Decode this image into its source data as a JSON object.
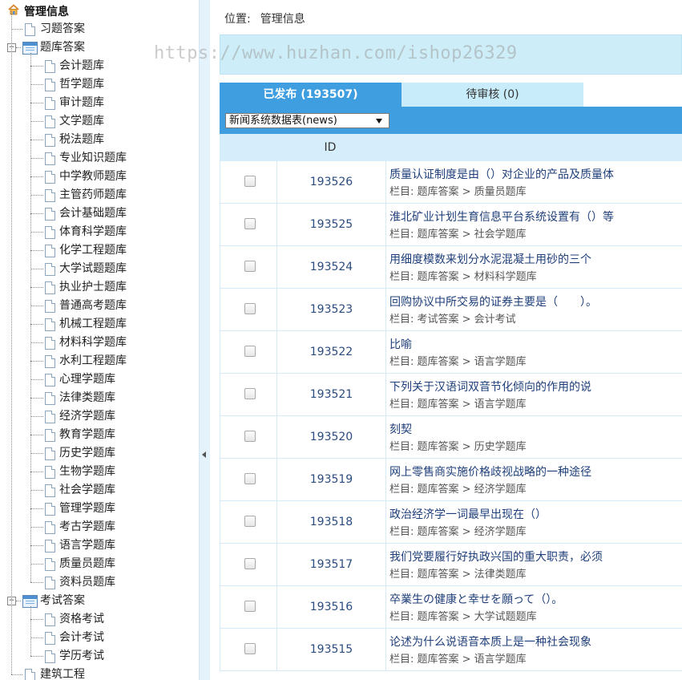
{
  "sidebar": {
    "root_label": "管理信息",
    "items": [
      {
        "label": "习题答案",
        "level": 1,
        "type": "doc"
      },
      {
        "label": "题库答案",
        "level": 1,
        "type": "folder",
        "expanded": true
      },
      {
        "label": "会计题库",
        "level": 2,
        "type": "doc"
      },
      {
        "label": "哲学题库",
        "level": 2,
        "type": "doc"
      },
      {
        "label": "审计题库",
        "level": 2,
        "type": "doc"
      },
      {
        "label": "文学题库",
        "level": 2,
        "type": "doc"
      },
      {
        "label": "税法题库",
        "level": 2,
        "type": "doc"
      },
      {
        "label": "专业知识题库",
        "level": 2,
        "type": "doc"
      },
      {
        "label": "中学教师题库",
        "level": 2,
        "type": "doc"
      },
      {
        "label": "主管药师题库",
        "level": 2,
        "type": "doc"
      },
      {
        "label": "会计基础题库",
        "level": 2,
        "type": "doc"
      },
      {
        "label": "体育科学题库",
        "level": 2,
        "type": "doc"
      },
      {
        "label": "化学工程题库",
        "level": 2,
        "type": "doc"
      },
      {
        "label": "大学试题题库",
        "level": 2,
        "type": "doc"
      },
      {
        "label": "执业护士题库",
        "level": 2,
        "type": "doc"
      },
      {
        "label": "普通高考题库",
        "level": 2,
        "type": "doc"
      },
      {
        "label": "机械工程题库",
        "level": 2,
        "type": "doc"
      },
      {
        "label": "材料科学题库",
        "level": 2,
        "type": "doc"
      },
      {
        "label": "水利工程题库",
        "level": 2,
        "type": "doc"
      },
      {
        "label": "心理学题库",
        "level": 2,
        "type": "doc"
      },
      {
        "label": "法律类题库",
        "level": 2,
        "type": "doc"
      },
      {
        "label": "经济学题库",
        "level": 2,
        "type": "doc"
      },
      {
        "label": "教育学题库",
        "level": 2,
        "type": "doc"
      },
      {
        "label": "历史学题库",
        "level": 2,
        "type": "doc"
      },
      {
        "label": "生物学题库",
        "level": 2,
        "type": "doc"
      },
      {
        "label": "社会学题库",
        "level": 2,
        "type": "doc"
      },
      {
        "label": "管理学题库",
        "level": 2,
        "type": "doc"
      },
      {
        "label": "考古学题库",
        "level": 2,
        "type": "doc"
      },
      {
        "label": "语言学题库",
        "level": 2,
        "type": "doc"
      },
      {
        "label": "质量员题库",
        "level": 2,
        "type": "doc"
      },
      {
        "label": "资料员题库",
        "level": 2,
        "type": "doc"
      },
      {
        "label": "考试答案",
        "level": 1,
        "type": "folder",
        "expanded": true
      },
      {
        "label": "资格考试",
        "level": 2,
        "type": "doc"
      },
      {
        "label": "会计考试",
        "level": 2,
        "type": "doc"
      },
      {
        "label": "学历考试",
        "level": 2,
        "type": "doc"
      },
      {
        "label": "建筑工程",
        "level": 1,
        "type": "doc"
      }
    ]
  },
  "breadcrumb": {
    "label": "位置:",
    "value": "管理信息"
  },
  "watermark": "https://www.huzhan.com/ishop26329",
  "tabs": [
    {
      "label": "已发布 (193507)",
      "active": true
    },
    {
      "label": "待审核 (0)",
      "active": false
    }
  ],
  "filter": {
    "selected": "新闻系统数据表(news)"
  },
  "table": {
    "id_header": "ID",
    "rows": [
      {
        "id": "193526",
        "title": "质量认证制度是由（）对企业的产品及质量体",
        "category": "栏目: 题库答案 > 质量员题库"
      },
      {
        "id": "193525",
        "title": "淮北矿业计划生育信息平台系统设置有（）等",
        "category": "栏目: 题库答案 > 社会学题库"
      },
      {
        "id": "193524",
        "title": "用细度模数来划分水泥混凝土用砂的三个",
        "category": "栏目: 题库答案 > 材料科学题库"
      },
      {
        "id": "193523",
        "title": "回购协议中所交易的证券主要是（　　）。",
        "category": "栏目: 考试答案 > 会计考试"
      },
      {
        "id": "193522",
        "title": "比喻",
        "category": "栏目: 题库答案 > 语言学题库"
      },
      {
        "id": "193521",
        "title": "下列关于汉语词双音节化倾向的作用的说",
        "category": "栏目: 题库答案 > 语言学题库"
      },
      {
        "id": "193520",
        "title": "刻契",
        "category": "栏目: 题库答案 > 历史学题库"
      },
      {
        "id": "193519",
        "title": "网上零售商实施价格歧视战略的一种途径",
        "category": "栏目: 题库答案 > 经济学题库"
      },
      {
        "id": "193518",
        "title": "政治经济学一词最早出现在（）",
        "category": "栏目: 题库答案 > 经济学题库"
      },
      {
        "id": "193517",
        "title": "我们党要履行好执政兴国的重大职责，必须",
        "category": "栏目: 题库答案 > 法律类题库"
      },
      {
        "id": "193516",
        "title": "卒業生の健康と幸せを願って（）。",
        "category": "栏目: 题库答案 > 大学试题题库"
      },
      {
        "id": "193515",
        "title": "论述为什么说语音本质上是一种社会现象",
        "category": "栏目: 题库答案 > 语言学题库"
      }
    ]
  },
  "colors": {
    "accent": "#3e9edf",
    "light": "#c9ecfa",
    "link": "#1f3f7a"
  }
}
